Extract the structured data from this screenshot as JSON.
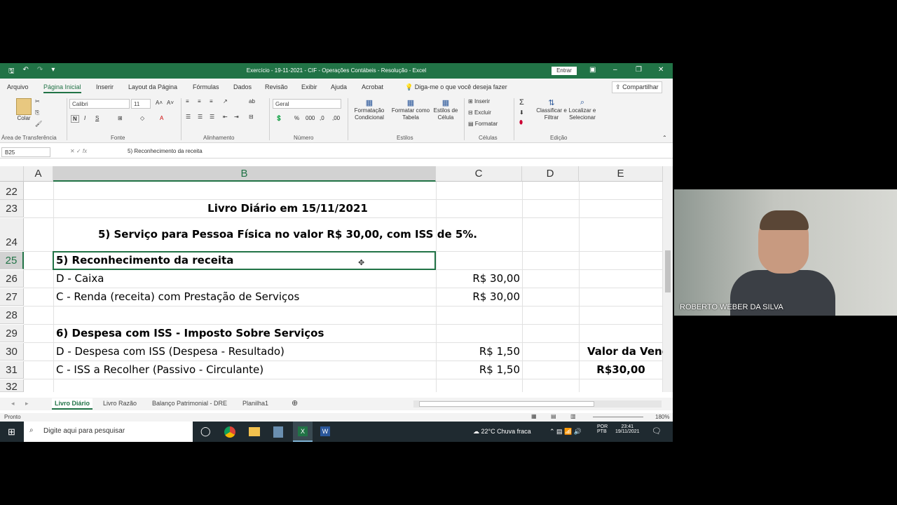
{
  "window": {
    "title": "Exercício - 19-11-2021 - CIF - Operações Contábeis - Resolução - Excel",
    "sign_in": "Entrar"
  },
  "menu": {
    "tabs": [
      "Arquivo",
      "Página Inicial",
      "Inserir",
      "Layout da Página",
      "Fórmulas",
      "Dados",
      "Revisão",
      "Exibir",
      "Ajuda",
      "Acrobat"
    ],
    "active_tab": "Página Inicial",
    "tell_me": "Diga-me o que você deseja fazer",
    "share": "Compartilhar"
  },
  "ribbon": {
    "paste": "Colar",
    "font_name": "Calibri",
    "font_size": "11",
    "number_format": "Geral",
    "conditional_format": "Formatação Condicional",
    "format_as_table": "Formatar como Tabela",
    "cell_styles": "Estilos de Célula",
    "insert": "Inserir",
    "delete": "Excluir",
    "format": "Formatar",
    "sort_filter": "Classificar e Filtrar",
    "find_select": "Localizar e Selecionar",
    "groups": {
      "clipboard": "Área de Transferência",
      "font": "Fonte",
      "alignment": "Alinhamento",
      "number": "Número",
      "styles": "Estilos",
      "cells": "Células",
      "editing": "Edição"
    }
  },
  "formula_bar": {
    "name_box": "B25",
    "content": "5) Reconhecimento da receita"
  },
  "columns": [
    "A",
    "B",
    "C",
    "D",
    "E"
  ],
  "rows": [
    {
      "num": "22",
      "b": "",
      "c": "",
      "e": ""
    },
    {
      "num": "23",
      "b": "Livro Diário em 15/11/2021",
      "c": "",
      "e": ""
    },
    {
      "num": "24",
      "b": "5) Serviço para Pessoa Física no valor R$ 30,00, com ISS de 5%.",
      "c": "",
      "e": ""
    },
    {
      "num": "25",
      "b": "5) Reconhecimento da receita",
      "c": "",
      "e": ""
    },
    {
      "num": "26",
      "b": "D - Caixa",
      "c": "R$ 30,00",
      "e": ""
    },
    {
      "num": "27",
      "b": "C - Renda (receita) com Prestação de Serviços",
      "c": "R$ 30,00",
      "e": ""
    },
    {
      "num": "28",
      "b": "",
      "c": "",
      "e": ""
    },
    {
      "num": "29",
      "b": "6) Despesa com ISS - Imposto Sobre Serviços",
      "c": "",
      "e": ""
    },
    {
      "num": "30",
      "b": "D - Despesa com ISS (Despesa - Resultado)",
      "c": "R$ 1,50",
      "e": "Valor da Vend"
    },
    {
      "num": "31",
      "b": "C - ISS a Recolher (Passivo - Circulante)",
      "c": "R$ 1,50",
      "e": "R$30,00"
    },
    {
      "num": "32",
      "b": "",
      "c": "",
      "e": ""
    }
  ],
  "sheets": [
    "Livro Diário",
    "Livro Razão",
    "Balanço Patrimonial - DRE",
    "Planilha1"
  ],
  "active_sheet": "Livro Diário",
  "status": {
    "ready": "Pronto",
    "zoom": "180%"
  },
  "taskbar": {
    "search_placeholder": "Digite aqui para pesquisar",
    "weather": "22°C  Chuva fraca",
    "lang": "POR",
    "lang2": "PTB",
    "time": "23:41",
    "date": "19/11/2021"
  },
  "video": {
    "participant": "ROBERTO WEBER DA SILVA"
  }
}
